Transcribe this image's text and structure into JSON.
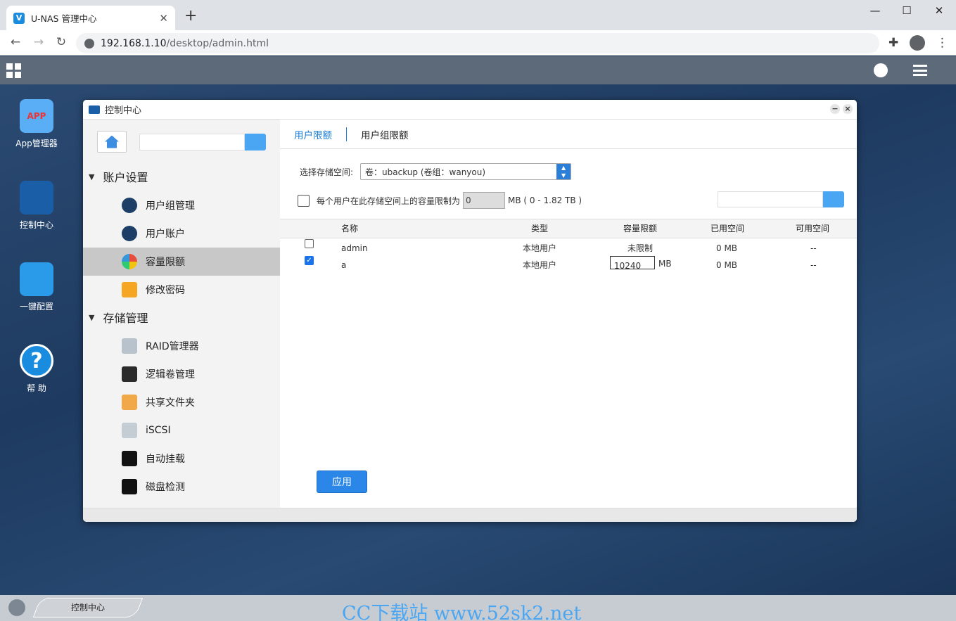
{
  "browser": {
    "tab_title": "U-NAS 管理中心",
    "url_host": "192.168.1.10",
    "url_path": "/desktop/admin.html"
  },
  "desktop_icons": [
    {
      "label": "App管理器",
      "badge": "APP"
    },
    {
      "label": "控制中心"
    },
    {
      "label": "一键配置"
    },
    {
      "label": "帮 助",
      "glyph": "?"
    }
  ],
  "taskbar": {
    "task_label": "控制中心"
  },
  "watermark": "CC下载站 www.52sk2.net",
  "window": {
    "title": "控制中心",
    "sidebar": {
      "sections": [
        {
          "label": "账户设置",
          "items": [
            {
              "label": "用户组管理",
              "icon": "user-group-icon"
            },
            {
              "label": "用户账户",
              "icon": "user-icon"
            },
            {
              "label": "容量限额",
              "icon": "quota-icon"
            },
            {
              "label": "修改密码",
              "icon": "lock-icon"
            }
          ]
        },
        {
          "label": "存储管理",
          "items": [
            {
              "label": "RAID管理器",
              "icon": "raid-icon"
            },
            {
              "label": "逻辑卷管理",
              "icon": "lvm-icon"
            },
            {
              "label": "共享文件夹",
              "icon": "shared-folder-icon"
            },
            {
              "label": "iSCSI",
              "icon": "iscsi-icon"
            },
            {
              "label": "自动挂载",
              "icon": "automount-icon"
            },
            {
              "label": "磁盘检测",
              "icon": "disk-check-icon"
            }
          ]
        }
      ]
    },
    "tabs": [
      "用户限额",
      "用户组限额"
    ],
    "storage_label": "选择存储空间:",
    "storage_value": "卷：ubackup (卷组：wanyou)",
    "limit_label": "每个用户在此存储空间上的容量限制为",
    "limit_value": "0",
    "limit_unit": "MB ( 0 - 1.82 TB )",
    "columns": [
      "名称",
      "类型",
      "容量限额",
      "已用空间",
      "可用空间"
    ],
    "rows": [
      {
        "name": "admin",
        "type": "本地用户",
        "quota": "未限制",
        "used": "0 MB",
        "avail": "--",
        "checked": false
      },
      {
        "name": "a",
        "type": "本地用户",
        "quota": "10240",
        "quota_unit": "MB",
        "used": "0 MB",
        "avail": "--",
        "checked": true
      }
    ],
    "apply_label": "应用"
  },
  "colors": {
    "accent": "#2a87e8",
    "tab_active": "#1a7cd8",
    "desktop_bg": "#1f3a5c"
  }
}
